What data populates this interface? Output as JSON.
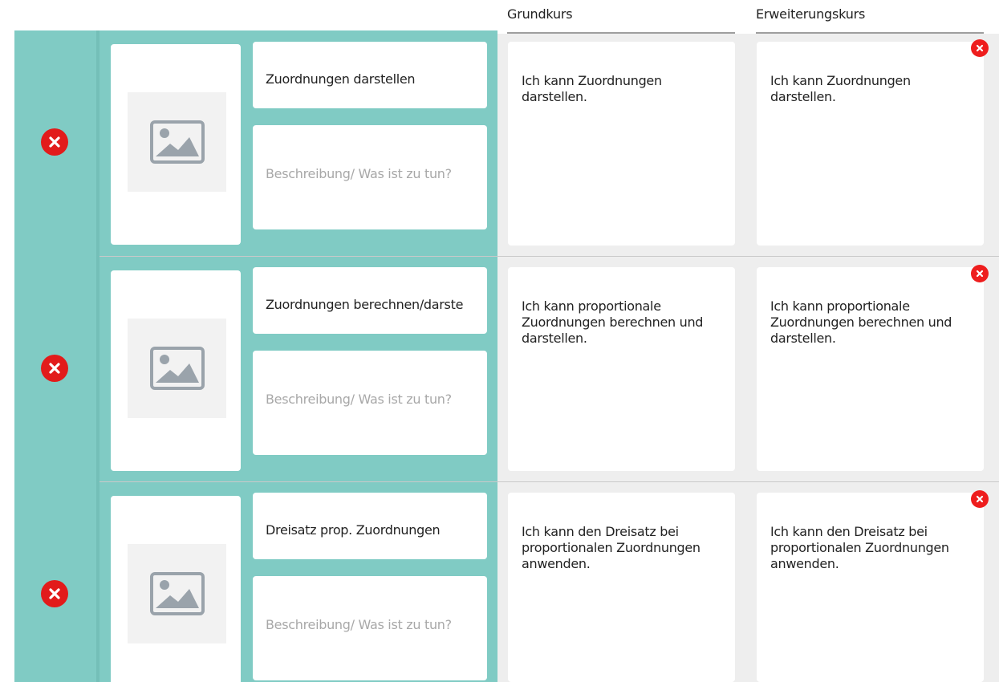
{
  "columns": {
    "grundkurs": "Grundkurs",
    "erweiterungskurs": "Erweiterungskurs"
  },
  "rows": [
    {
      "title": "Zuordnungen darstellen",
      "description_placeholder": "Beschreibung/ Was ist zu tun?",
      "grundkurs": "Ich kann Zuordnungen darstellen.",
      "erweiterungskurs": "Ich kann Zuordnungen darstellen."
    },
    {
      "title": "Zuordnungen berechnen/darste",
      "description_placeholder": "Beschreibung/ Was ist zu tun?",
      "grundkurs": "Ich kann proportionale Zuordnungen berechnen und darstellen.",
      "erweiterungskurs": "Ich kann proportionale Zuordnungen berechnen und darstellen."
    },
    {
      "title": "Dreisatz prop. Zuordnungen",
      "description_placeholder": "Beschreibung/ Was ist zu tun?",
      "grundkurs": "Ich kann den Dreisatz bei proportionalen Zuordnungen anwenden.",
      "erweiterungskurs": "Ich kann den Dreisatz bei proportionalen Zuordnungen anwenden."
    }
  ],
  "icons": {
    "remove_row": "remove-row-icon",
    "remove_card": "remove-card-icon",
    "image_placeholder": "image-placeholder-icon"
  },
  "colors": {
    "accent_teal": "#80cbc4",
    "remove_red": "#e21b1b",
    "panel_gray": "#eeeeee"
  }
}
